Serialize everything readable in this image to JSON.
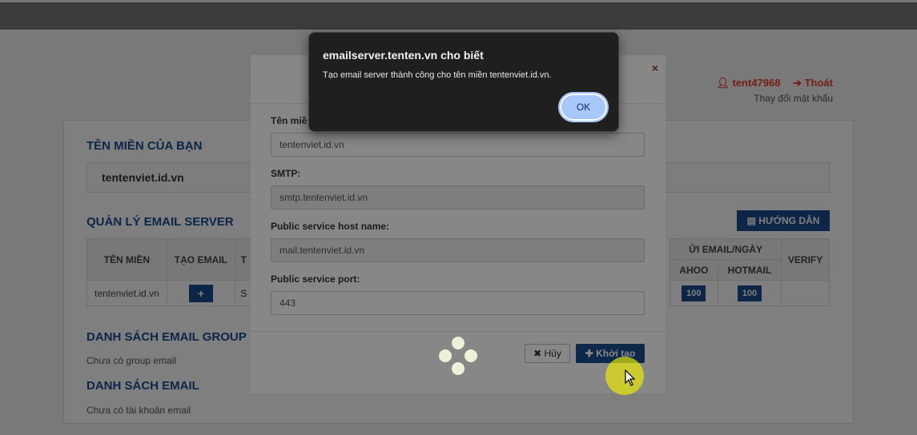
{
  "header": {
    "username": "tent47968",
    "logout_label": "Thoát",
    "change_password": "Thay đổi mật khẩu"
  },
  "domain_section": {
    "title": "TÊN MIỀN CỦA BẠN",
    "domain": "tentenviet.id.vn"
  },
  "server_section": {
    "title": "QUẢN LÝ EMAIL SERVER",
    "guide_button": "HƯỚNG DẪN",
    "col_domain": "TÊN MIỀN",
    "col_create": "TẠO EMAIL",
    "col_t": "T",
    "col_send_group": "ỬI EMAIL/NGÀY",
    "col_yahoo": "AHOO",
    "col_hotmail": "HOTMAIL",
    "col_verify": "VERIFY",
    "row": {
      "domain": "tentenviet.id.vn",
      "create": "+",
      "t": "S",
      "yahoo": "100",
      "hotmail": "100"
    }
  },
  "group_section": {
    "title": "DANH SÁCH EMAIL GROUP",
    "empty": "Chưa có group email"
  },
  "email_section": {
    "title": "DANH SÁCH EMAIL",
    "empty": "Chưa có tài khoản email"
  },
  "modal": {
    "close": "×",
    "fields": [
      {
        "label": "Tên miề",
        "value": "tentenviet.id.vn"
      },
      {
        "label": "SMTP:",
        "value": "smtp.tentenviet.id.vn"
      },
      {
        "label": "Public service host name:",
        "value": "mail.tentenviet.id.vn"
      },
      {
        "label": "Public service port:",
        "value": "443"
      }
    ],
    "cancel_label": "✖ Hủy",
    "create_label": "✚ Khởi tạo"
  },
  "alert": {
    "title": "emailserver.tenten.vn cho biết",
    "message": "Tạo email server thành công cho tên miền tentenviet.id.vn.",
    "ok_label": "OK"
  },
  "colors": {
    "brand_blue": "#1a4d8f",
    "danger": "#e8402a",
    "alert_ok": "#a8c7fa"
  }
}
